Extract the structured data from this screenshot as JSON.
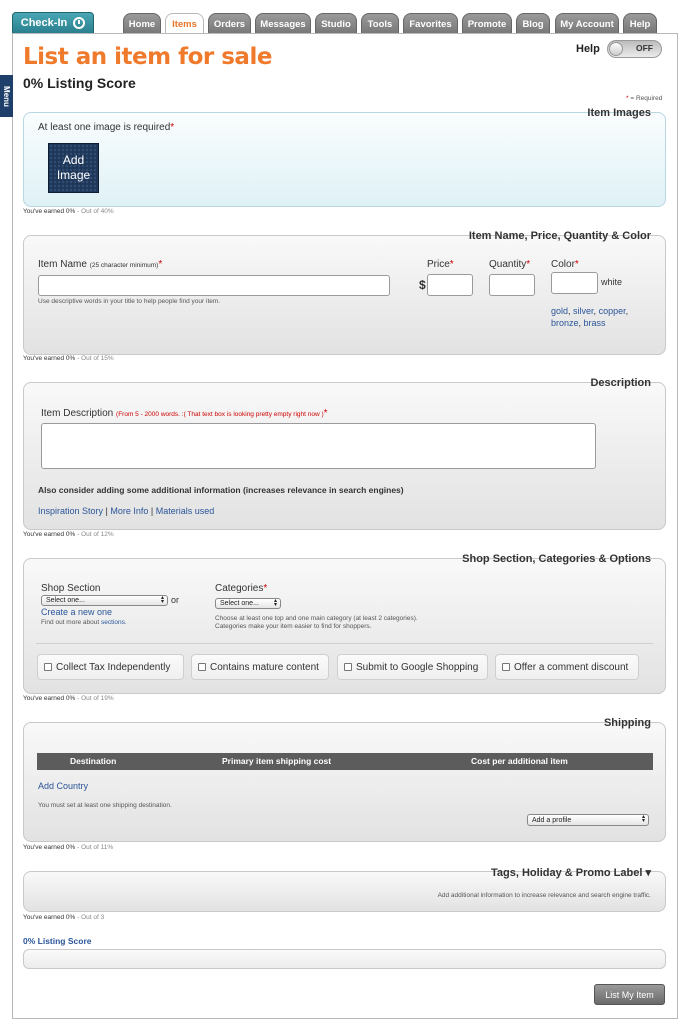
{
  "nav": {
    "checkin": "Check-In",
    "tabs": [
      {
        "label": "Home"
      },
      {
        "label": "Items"
      },
      {
        "label": "Orders"
      },
      {
        "label": "Messages"
      },
      {
        "label": "Studio"
      },
      {
        "label": "Tools"
      },
      {
        "label": "Favorites"
      },
      {
        "label": "Promote"
      },
      {
        "label": "Blog"
      },
      {
        "label": "My Account"
      },
      {
        "label": "Help"
      }
    ],
    "active_tab": "Items",
    "menu_label": "Menu"
  },
  "header": {
    "title": "List an item for sale",
    "listing_score": "0% Listing Score",
    "help_label": "Help",
    "help_toggle": "OFF",
    "required_star": "*",
    "required_note": " = Required"
  },
  "images": {
    "section_title": "Item Images",
    "instruction": "At least one image is required",
    "star": "*",
    "add_button_line1": "Add",
    "add_button_line2": "Image",
    "earned": "You've earned 0%",
    "out_of": " - Out of 40%"
  },
  "name_price": {
    "section_title": "Item Name, Price, Quantity & Color",
    "item_name_label": "Item Name",
    "item_name_hint": "(25 character minimum)",
    "star": "*",
    "item_name_help": "Use descriptive words in your title to help people find your item.",
    "price_label": "Price",
    "currency": "$",
    "quantity_label": "Quantity",
    "color_label": "Color",
    "color_value": "white",
    "color_suggestions": [
      "gold",
      "silver",
      "copper",
      "bronze",
      "brass"
    ],
    "earned": "You've earned 0%",
    "out_of": " - Out of 15%"
  },
  "description": {
    "section_title": "Description",
    "label": "Item Description",
    "hint": "(From 5 - 2000 words. :( That text box is looking pretty empty right now )",
    "star": "*",
    "consider": "Also consider adding some additional information (increases relevance in search engines)",
    "links": [
      "Inspiration Story",
      "More Info",
      "Materials used"
    ],
    "separator": " | ",
    "earned": "You've earned 0%",
    "out_of": " - Out of 12%"
  },
  "shop": {
    "section_title": "Shop Section, Categories & Options",
    "shop_section_label": "Shop Section",
    "shop_section_select": "Select one...",
    "or_text": "or",
    "create_new": "Create a new one",
    "find_more_prefix": "Find out more about ",
    "find_more_link": "sections",
    "find_more_suffix": ".",
    "categories_label": "Categories",
    "star": "*",
    "categories_select": "Select one...",
    "categories_help_1": "Choose at least one top and one main category (at least 2 categories).",
    "categories_help_2": "Categories make your item easier to find for shoppers.",
    "options": [
      {
        "label": "Collect Tax Independently"
      },
      {
        "label": "Contains mature content"
      },
      {
        "label": "Submit to Google Shopping"
      },
      {
        "label": "Offer a comment discount"
      }
    ],
    "earned": "You've earned 0%",
    "out_of": " - Out of 19%"
  },
  "shipping": {
    "section_title": "Shipping",
    "columns": [
      "Destination",
      "Primary item shipping cost",
      "Cost per additional item"
    ],
    "add_country": "Add Country",
    "note": "You must set at least one shipping destination.",
    "profile_select": "Add a profile",
    "earned": "You've earned 0%",
    "out_of": " - Out of 11%"
  },
  "tags": {
    "section_title": "Tags, Holiday & Promo Label",
    "info": "Add additional information to increase relevance and search engine traffic.",
    "earned": "You've earned 0%",
    "out_of": " - Out of 3"
  },
  "footer": {
    "score_label": "0% Listing Score",
    "list_button": "List My Item"
  },
  "colors": {
    "accent_orange": "#f07a2c",
    "link_blue": "#2a5599",
    "required_red": "#cc0000",
    "menu_navy": "#1f3f6b",
    "checkin_teal": "#2a7f8d"
  }
}
